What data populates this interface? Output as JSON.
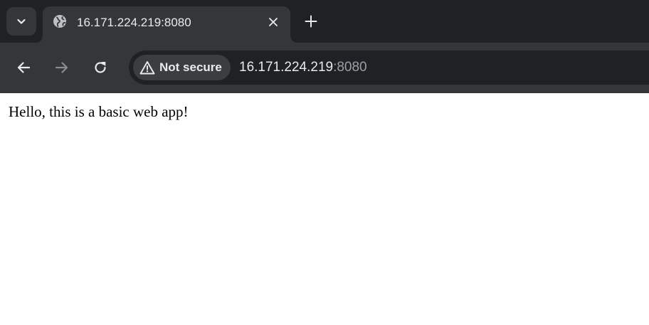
{
  "browser": {
    "tab": {
      "title": "16.171.224.219:8080",
      "favicon_icon": "globe-icon",
      "close_icon": "close-icon"
    },
    "tab_search_icon": "chevron-down-icon",
    "new_tab_icon": "plus-icon",
    "toolbar": {
      "back_icon": "arrow-left-icon",
      "forward_icon": "arrow-right-icon",
      "reload_icon": "reload-icon"
    },
    "omnibox": {
      "security_icon": "warning-triangle-icon",
      "security_label": "Not secure",
      "url_host": "16.171.224.219",
      "url_port": ":8080"
    },
    "colors": {
      "tabstrip_bg": "#202124",
      "active_tab_bg": "#35363a",
      "omnibox_bg": "#202124",
      "text_primary": "#e8eaed",
      "text_secondary": "#9aa0a6"
    }
  },
  "page": {
    "body_text": "Hello, this is a basic web app!"
  }
}
